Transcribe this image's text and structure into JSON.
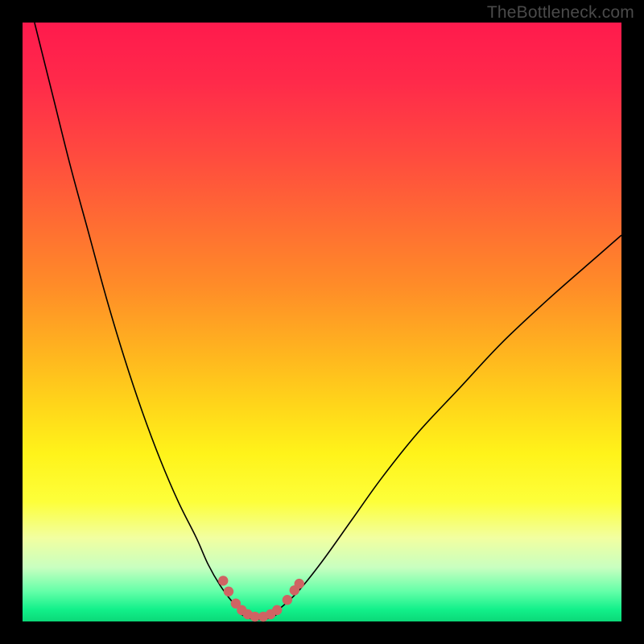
{
  "watermark": "TheBottleneck.com",
  "colors": {
    "frame_bg_top": "#ff1a4d",
    "frame_bg_bottom": "#0bd878",
    "curve": "#000000",
    "dots": "#cf6363",
    "page_bg": "#000000",
    "watermark": "#4a4a4a"
  },
  "chart_data": {
    "type": "line",
    "title": "",
    "xlabel": "",
    "ylabel": "",
    "xlim": [
      0,
      100
    ],
    "ylim": [
      0,
      100
    ],
    "grid": false,
    "legend": false,
    "series": [
      {
        "name": "left-curve",
        "x": [
          2,
          5,
          8,
          11,
          14,
          17,
          20,
          23,
          26,
          29,
          31,
          33,
          35,
          36.5,
          38
        ],
        "y": [
          100,
          88,
          76,
          65,
          54,
          44,
          35,
          27,
          20,
          14,
          9.5,
          6,
          3.3,
          1.8,
          0.8
        ]
      },
      {
        "name": "right-curve",
        "x": [
          41,
          43,
          46,
          50,
          55,
          60,
          66,
          73,
          80,
          88,
          96,
          100
        ],
        "y": [
          0.8,
          2.2,
          5,
          10,
          17,
          24,
          31.5,
          39,
          46.5,
          54,
          61,
          64.5
        ]
      },
      {
        "name": "flat-bottom",
        "x": [
          36,
          37,
          38,
          39,
          40,
          41,
          42,
          43
        ],
        "y": [
          1.6,
          0.9,
          0.5,
          0.35,
          0.35,
          0.5,
          0.9,
          1.6
        ]
      }
    ],
    "scatter_overlay": {
      "name": "marker-dots",
      "points": [
        {
          "x": 33.5,
          "y": 6.8
        },
        {
          "x": 34.4,
          "y": 5.0
        },
        {
          "x": 35.6,
          "y": 3.0
        },
        {
          "x": 36.6,
          "y": 1.9
        },
        {
          "x": 37.6,
          "y": 1.2
        },
        {
          "x": 38.8,
          "y": 0.8
        },
        {
          "x": 40.2,
          "y": 0.8
        },
        {
          "x": 41.4,
          "y": 1.2
        },
        {
          "x": 42.5,
          "y": 1.9
        },
        {
          "x": 44.2,
          "y": 3.6
        },
        {
          "x": 45.4,
          "y": 5.2
        },
        {
          "x": 46.2,
          "y": 6.3
        }
      ]
    }
  }
}
